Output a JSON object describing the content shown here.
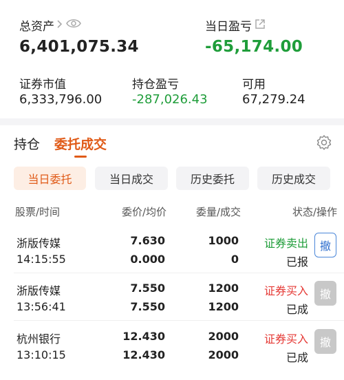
{
  "summary": {
    "total_assets_label": "总资产",
    "total_assets_value": "6,401,075.34",
    "today_pnl_label": "当日盈亏",
    "today_pnl_value": "-65,174.00",
    "market_value_label": "证券市值",
    "market_value_value": "6,333,796.00",
    "position_pnl_label": "持仓盈亏",
    "position_pnl_value": "-287,026.43",
    "available_label": "可用",
    "available_value": "67,279.24"
  },
  "tabs": [
    {
      "label": "持仓"
    },
    {
      "label": "委托成交"
    }
  ],
  "segments": [
    {
      "label": "当日委托"
    },
    {
      "label": "当日成交"
    },
    {
      "label": "历史委托"
    },
    {
      "label": "历史成交"
    }
  ],
  "table": {
    "headers": {
      "stock_time": "股票/时间",
      "price_avg": "委价/均价",
      "qty_filled": "委量/成交",
      "status_action": "状态/操作"
    },
    "rows": [
      {
        "name": "浙版传媒",
        "time": "14:15:55",
        "price": "7.630",
        "avg": "0.000",
        "qty": "1000",
        "filled": "0",
        "side": "证券卖出",
        "status": "已报",
        "action": "撤"
      },
      {
        "name": "浙版传媒",
        "time": "13:56:41",
        "price": "7.550",
        "avg": "7.550",
        "qty": "1200",
        "filled": "1200",
        "side": "证券买入",
        "status": "已成",
        "action": "撤"
      },
      {
        "name": "杭州银行",
        "time": "13:10:15",
        "price": "12.430",
        "avg": "12.430",
        "qty": "2000",
        "filled": "2000",
        "side": "证券买入",
        "status": "已成",
        "action": "撤"
      }
    ]
  },
  "colors": {
    "accent": "#e05a17",
    "gain_loss_green": "#1f9d3a",
    "buy_red": "#e53935",
    "sell_green": "#1f9d3a",
    "cancel_blue": "#2f6fce"
  },
  "icons": [
    "chevron-right-icon",
    "eye-icon",
    "external-link-icon",
    "gear-icon"
  ]
}
